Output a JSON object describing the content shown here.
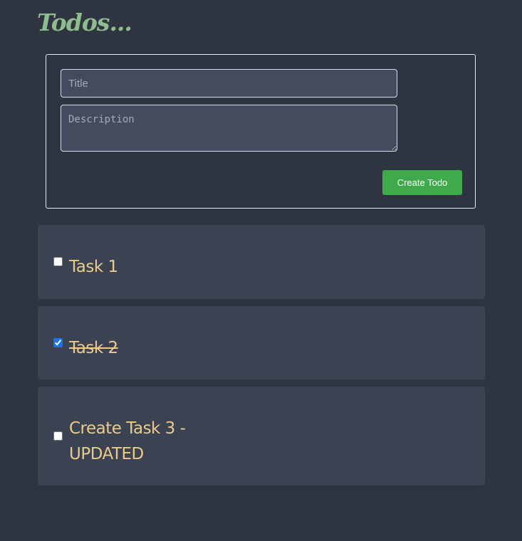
{
  "app": {
    "title": "Todos..."
  },
  "form": {
    "title_placeholder": "Title",
    "title_value": "",
    "description_placeholder": "Description",
    "description_value": "",
    "create_label": "Create Todo"
  },
  "todos": [
    {
      "label": "Task 1",
      "completed": false
    },
    {
      "label": "Task 2",
      "completed": true
    },
    {
      "label_line1": "Create Task 3 -",
      "label_line2": "UPDATED",
      "completed": false
    }
  ],
  "colors": {
    "background": "#2e3440",
    "card": "#3b4252",
    "input": "#434c5e",
    "title": "#8fbc8f",
    "todo_text": "#ebcb8b",
    "button": "#3faa4b"
  }
}
